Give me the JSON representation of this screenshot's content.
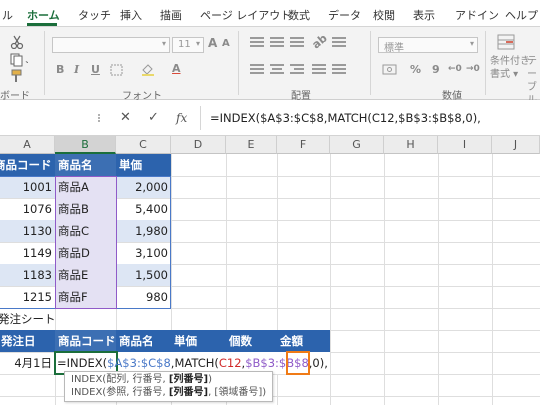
{
  "ribbon_tabs": [
    "ル",
    "ホーム",
    "タッチ",
    "挿入",
    "描画",
    "ページ レイアウト",
    "数式",
    "データ",
    "校閲",
    "表示",
    "アドイン",
    "ヘルプ"
  ],
  "ribbon": {
    "font_name": "",
    "font_size": "11",
    "number_format": "標準",
    "groups": {
      "clipboard": "ボード",
      "font": "フォント",
      "alignment": "配置",
      "number": "数値"
    },
    "conditional_format": [
      "条件付き",
      "書式"
    ],
    "format_as_table": [
      "テーブル",
      "書式"
    ],
    "bold": "B",
    "italic": "I",
    "underline": "U",
    "percent": "%",
    "comma": "9"
  },
  "formula_bar": {
    "cancel_glyph": "✕",
    "enter_glyph": "✓",
    "fx": "fx",
    "formula": "=INDEX($A$3:$C$8,MATCH(C12,$B$3:$B$8,0),"
  },
  "columns": [
    "A",
    "B",
    "C",
    "D",
    "E",
    "F",
    "G",
    "H",
    "I",
    "J"
  ],
  "product_table": {
    "headers": [
      "商品コード",
      "商品名",
      "単価"
    ],
    "rows": [
      [
        "1001",
        "商品A",
        "2,000"
      ],
      [
        "1076",
        "商品B",
        "5,400"
      ],
      [
        "1130",
        "商品C",
        "1,980"
      ],
      [
        "1149",
        "商品D",
        "3,100"
      ],
      [
        "1183",
        "商品E",
        "1,500"
      ],
      [
        "1215",
        "商品F",
        "980"
      ]
    ]
  },
  "order_sheet": {
    "title": "発注シート",
    "headers": [
      "発注日",
      "商品コード",
      "商品名",
      "単価",
      "個数",
      "金額"
    ],
    "date": "4月1日"
  },
  "edit": {
    "parts": [
      "=INDEX(",
      "$A$3:$C$8",
      ",MATCH(",
      "C12",
      ",",
      "$B$3:$B$8",
      ",",
      "0)",
      ","
    ]
  },
  "tooltip": {
    "line1_pre": "INDEX(配列, 行番号, ",
    "line1_bold": "[列番号]",
    "line1_post": ")",
    "line2_pre": "INDEX(参照, 行番号, ",
    "line2_bold": "[列番号]",
    "line2_post": ", [領域番号])"
  }
}
